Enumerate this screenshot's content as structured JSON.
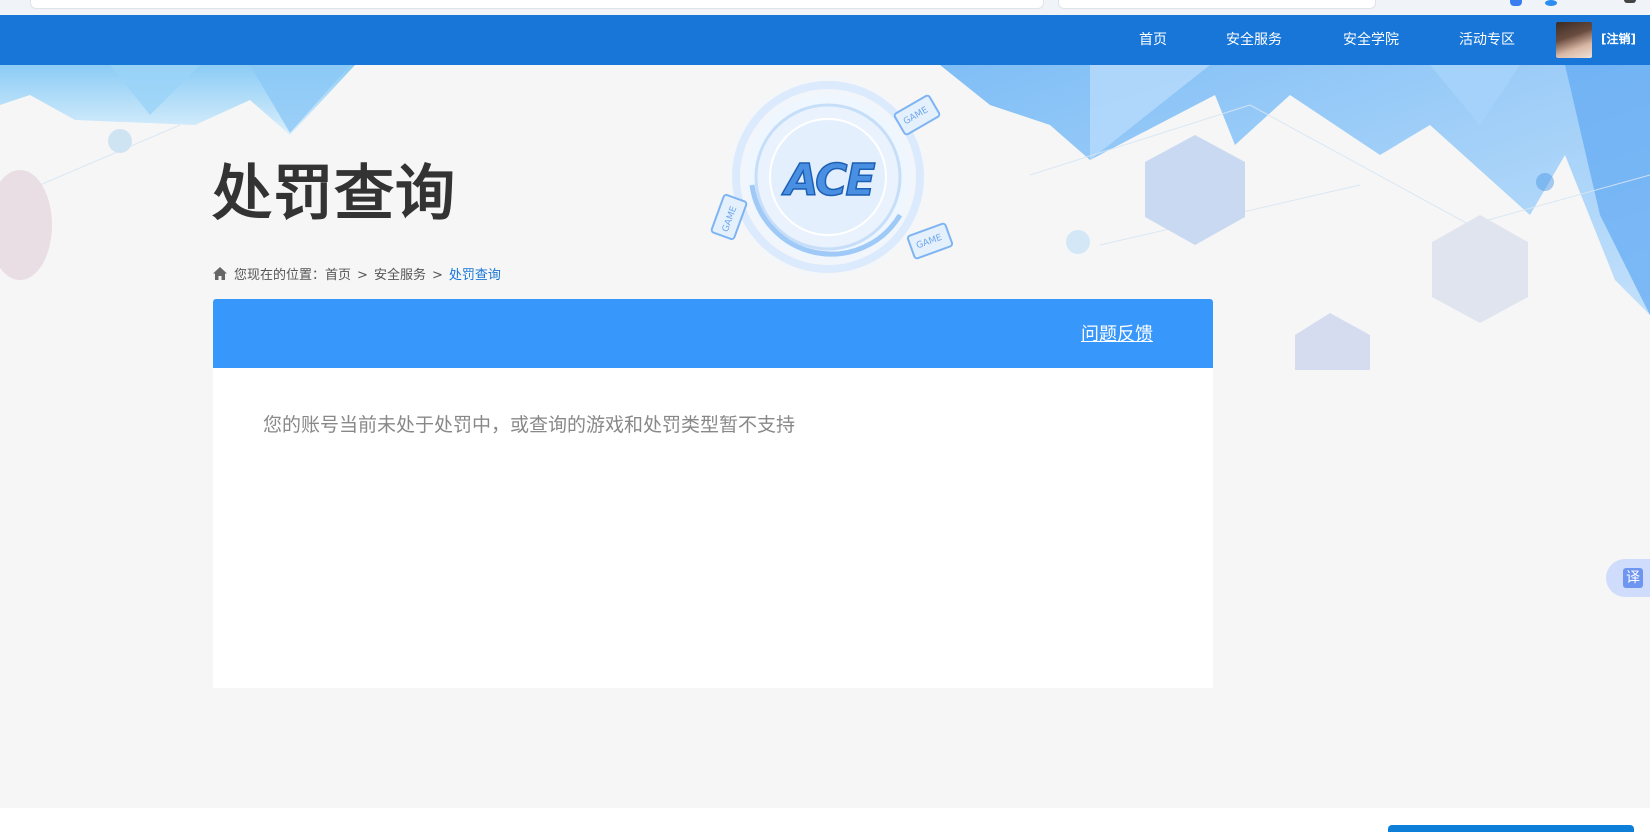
{
  "nav": {
    "items": [
      "首页",
      "安全服务",
      "安全学院",
      "活动专区"
    ],
    "logout": "[注销]"
  },
  "banner": {
    "title": "处罚查询",
    "logo_text": "ACE",
    "badge_text": "GAME"
  },
  "breadcrumb": {
    "prefix": "您现在的位置：",
    "items": [
      "首页",
      "安全服务",
      "处罚查询"
    ],
    "separator": ">"
  },
  "panel": {
    "feedback_label": "问题反馈",
    "notice": "您的账号当前未处于处罚中，或查询的游戏和处罚类型暂不支持"
  },
  "widgets": {
    "translate_label": "译"
  },
  "colors": {
    "header": "#1776d8",
    "panel_head": "#3897fb",
    "breadcrumb_current": "#1776d8"
  }
}
